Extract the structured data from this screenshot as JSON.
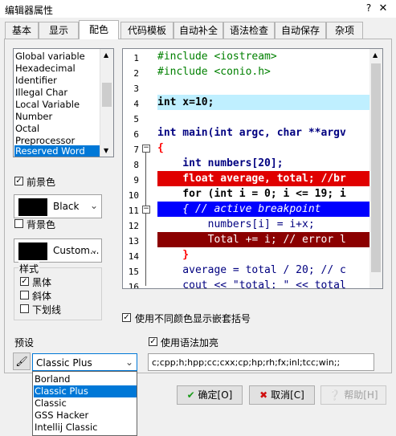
{
  "window": {
    "title": "编辑器属性",
    "help_btn": "?",
    "close_btn": "✕"
  },
  "tabs": [
    "基本",
    "显示",
    "配色",
    "代码模板",
    "自动补全",
    "语法检查",
    "自动保存",
    "杂项"
  ],
  "element_list": [
    "Global variable",
    "Hexadecimal",
    "Identifier",
    "Illegal Char",
    "Local Variable",
    "Number",
    "Octal",
    "Preprocessor",
    "Reserved Word"
  ],
  "foreground": {
    "label": "前景色",
    "value": "Black"
  },
  "background": {
    "label": "背景色",
    "value": "Custom..."
  },
  "style": {
    "legend": "样式",
    "bold": "黑体",
    "italic": "斜体",
    "underline": "下划线"
  },
  "code": {
    "line_numbers": [
      "1",
      "2",
      "3",
      "4",
      "5",
      "6",
      "7",
      "8",
      "9",
      "10",
      "11",
      "12",
      "13",
      "14",
      "15",
      "16"
    ],
    "lines": [
      "#include <iostream>",
      "#include <conio.h>",
      "",
      "int x=10;",
      "",
      "int main(int argc, char **argv",
      "{",
      "    int numbers[20];",
      "    float average, total; //br",
      "    for (int i = 0; i <= 19; i",
      "    { // active breakpoint",
      "        numbers[i] = i+x;",
      "        Total += i; // error l",
      "    }",
      "    average = total / 20; // c",
      "    cout << \"total: \" << total"
    ]
  },
  "options": {
    "nested_brackets": "使用不同颜色显示嵌套括号",
    "syntax_highlight": "使用语法加亮"
  },
  "preset": {
    "label": "预设",
    "value": "Classic Plus",
    "options": [
      "Borland",
      "Classic Plus",
      "Classic",
      "GSS Hacker",
      "Intellij Classic"
    ]
  },
  "extensions": "c;cpp;h;hpp;cc;cxx;cp;hp;rh;fx;inl;tcc;win;;",
  "buttons": {
    "ok": "确定[O]",
    "cancel": "取消[C]",
    "help": "帮助[H]"
  },
  "colors": {
    "selection": "#0078d7",
    "current_line": "#bfefff",
    "error_line": "#e00000",
    "active_line": "#0000ff",
    "breakpoint_line": "#8b0000",
    "keyword": "#000000",
    "preproc": "#008000",
    "operator": "#ff0000"
  }
}
